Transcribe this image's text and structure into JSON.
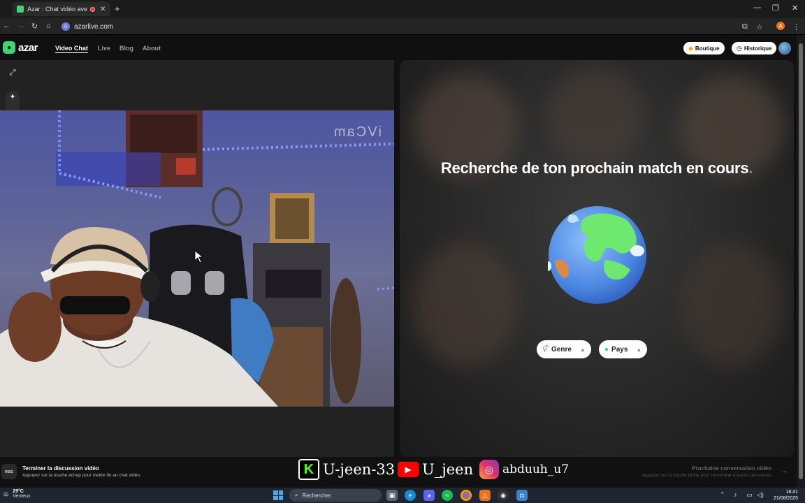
{
  "browser": {
    "tab_title": "Azar : Chat vidéo avec de n",
    "url": "azarlive.com",
    "new_tab": "+",
    "profile_initial": "A"
  },
  "site": {
    "logo_text": "azar",
    "nav": [
      {
        "label": "Video Chat",
        "active": true
      },
      {
        "label": "Live"
      },
      {
        "label": "Blog"
      },
      {
        "label": "About"
      }
    ],
    "boutique_label": "Boutique",
    "historique_label": "Historique"
  },
  "camera": {
    "watermark": "iVCam"
  },
  "match": {
    "title": "Recherche de ton prochain match en cours",
    "title_dot": ".",
    "filters": [
      {
        "label": "Genre",
        "icon": "gender-icon"
      },
      {
        "label": "Pays",
        "icon": "globe-small-icon"
      }
    ]
  },
  "bottom": {
    "esc_label": "esc",
    "end_title": "Terminer la discussion vidéo",
    "end_sub": "Appuyez sur la touche échap pour mettre fin au chat vidéo.",
    "next_title": "Prochaine conversation vidéo",
    "next_sub": "Appuyez sur la touche droite pour rencontrer d'autres personnes"
  },
  "social": {
    "kick_handle": "U-jeen-33",
    "youtube_handle": "U_jeen",
    "instagram_handle": "abduuh_u7"
  },
  "taskbar": {
    "temperature": "29°C",
    "weather": "Venteux",
    "search_placeholder": "Rechercher",
    "time": "18:41",
    "date": "21/08/2025"
  },
  "colors": {
    "brand_green": "#3ed37a",
    "globe_ocean": "#4a86e0",
    "globe_land": "#6ee86e"
  }
}
